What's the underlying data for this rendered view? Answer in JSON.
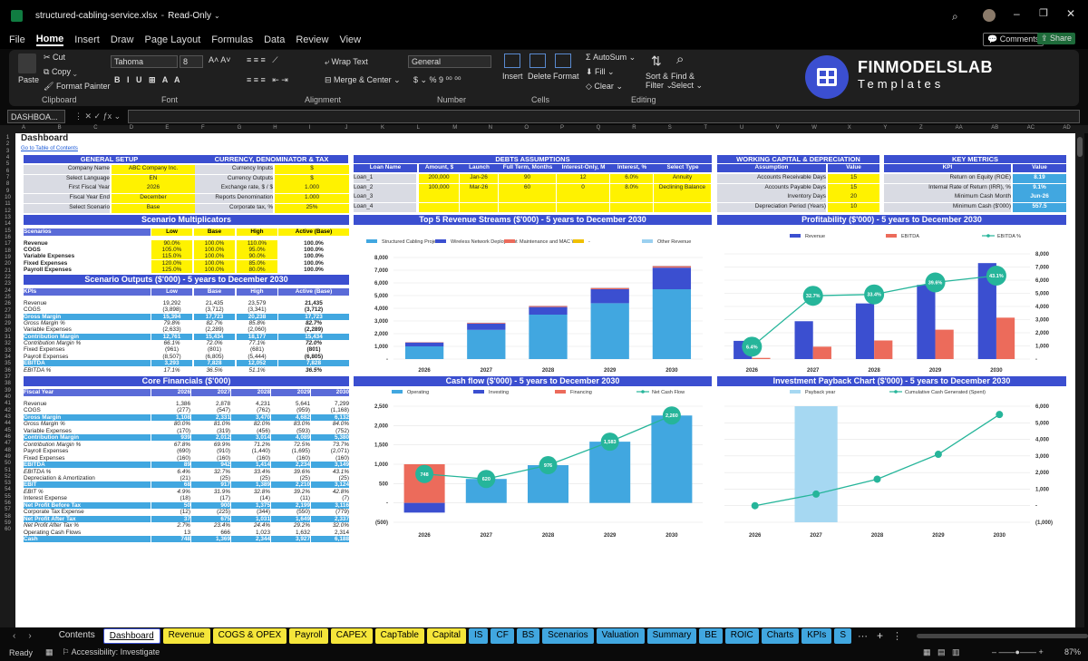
{
  "window": {
    "file": "structured-cabling-service.xlsx",
    "mode": "Read-Only"
  },
  "menus": [
    "File",
    "Home",
    "Insert",
    "Draw",
    "Page Layout",
    "Formulas",
    "Data",
    "Review",
    "View"
  ],
  "top_right": {
    "comments": "Comments",
    "share": "Share"
  },
  "ribbon": {
    "paste": "Paste",
    "cut": "Cut",
    "copy": "Copy",
    "format_painter": "Format Painter",
    "clipboard": "Clipboard",
    "font_name": "Tahoma",
    "font_size": "8",
    "font": "Font",
    "wrap": "Wrap Text",
    "merge": "Merge & Center",
    "alignment": "Alignment",
    "number_format": "General",
    "number": "Number",
    "insert": "Insert",
    "delete": "Delete",
    "format": "Format",
    "cells": "Cells",
    "autosum": "AutoSum",
    "fill": "Fill",
    "clear": "Clear",
    "sort": "Sort &",
    "sort2": "Filter",
    "find": "Find &",
    "find2": "Select",
    "editing": "Editing",
    "brand1": "FINMODELSLAB",
    "brand2": "Templates"
  },
  "namebox": "DASHBOA...",
  "columns": [
    "A",
    "B",
    "C",
    "D",
    "E",
    "F",
    "G",
    "H",
    "I",
    "J",
    "K",
    "L",
    "M",
    "N",
    "O",
    "P",
    "Q",
    "R",
    "S",
    "T",
    "U",
    "V",
    "W",
    "X",
    "Y",
    "Z",
    "AA",
    "AB",
    "AC",
    "AD"
  ],
  "sheet": {
    "title": "Dashboard",
    "link": "Go to Table of Contents",
    "general": {
      "title": "GENERAL SETUP",
      "rows": [
        [
          "Company Name",
          "ABC Company Inc."
        ],
        [
          "Select Language",
          "EN"
        ],
        [
          "First Fiscal Year",
          "2026"
        ],
        [
          "Fiscal Year End",
          "December"
        ],
        [
          "Select Scenario",
          "Base"
        ]
      ]
    },
    "currency": {
      "title": "CURRENCY, DENOMINATOR & TAX",
      "rows": [
        [
          "Currency Inputs",
          "$"
        ],
        [
          "Currency Outputs",
          "$"
        ],
        [
          "Exchange rate, $ / $",
          "1.000"
        ],
        [
          "Reports Denomination",
          "1.000"
        ],
        [
          "Corporate tax, %",
          "25%"
        ]
      ]
    },
    "debts": {
      "title": "DEBTS ASSUMPTIONS",
      "headers": [
        "Loan Name",
        "Amount, $",
        "Launch",
        "Full Term, Months",
        "Interest-Only, M",
        "Interest, %",
        "Select Type"
      ],
      "rows": [
        [
          "Loan_1",
          "200,000",
          "Jan-26",
          "90",
          "12",
          "6.0%",
          "Annuity"
        ],
        [
          "Loan_2",
          "100,000",
          "Mar-26",
          "60",
          "0",
          "8.0%",
          "Declining Balance"
        ],
        [
          "Loan_3",
          "",
          "",
          "",
          "",
          "",
          ""
        ],
        [
          "Loan_4",
          "",
          "",
          "",
          "",
          "",
          ""
        ]
      ]
    },
    "wc": {
      "title": "WORKING CAPITAL & DEPRECIATION",
      "headers": [
        "Assumption",
        "Value"
      ],
      "rows": [
        [
          "Accounts Receivable Days",
          "15"
        ],
        [
          "Accounts Payable Days",
          "15"
        ],
        [
          "Inventory Days",
          "20"
        ],
        [
          "Depreciation Period (Years)",
          "10"
        ]
      ]
    },
    "kpi": {
      "title": "KEY METRICS",
      "headers": [
        "KPI",
        "Value"
      ],
      "rows": [
        [
          "Return on Equity (ROE)",
          "8.19"
        ],
        [
          "Internal Rate of Return (IRR), %",
          "9.1%"
        ],
        [
          "Minimum Cash Month",
          "Jun-26"
        ],
        [
          "Minimum Cash ($'000)",
          "557.5"
        ]
      ]
    },
    "scen": {
      "title": "Scenario Multiplicators",
      "headers": [
        "Scenarios",
        "Low",
        "Base",
        "High",
        "Active (Base)"
      ],
      "rows": [
        [
          "Revenue",
          "90.0%",
          "100.0%",
          "110.0%",
          "100.0%"
        ],
        [
          "COGS",
          "105.0%",
          "100.0%",
          "95.0%",
          "100.0%"
        ],
        [
          "Variable Expenses",
          "115.0%",
          "100.0%",
          "90.0%",
          "100.0%"
        ],
        [
          "Fixed Expenses",
          "120.0%",
          "100.0%",
          "85.0%",
          "100.0%"
        ],
        [
          "Payroll Expenses",
          "125.0%",
          "100.0%",
          "80.0%",
          "100.0%"
        ]
      ]
    },
    "outputs": {
      "title": "Scenario Outputs ($'000) - 5 years to December 2030",
      "headers": [
        "KPIs",
        "Low",
        "Base",
        "High",
        "Active (Base)"
      ],
      "rows": [
        [
          "Revenue",
          "19,292",
          "21,435",
          "23,579",
          "21,435"
        ],
        [
          "COGS",
          "(3,898)",
          "(3,712)",
          "(3,341)",
          "(3,712)"
        ],
        [
          "Gross Margin",
          "15,394",
          "17,723",
          "20,238",
          "17,723"
        ],
        [
          "Gross Margin %",
          "79.8%",
          "82.7%",
          "85.8%",
          "82.7%"
        ],
        [
          "Variable Expenses",
          "(2,633)",
          "(2,289)",
          "(2,060)",
          "(2,289)"
        ],
        [
          "Contribution Margin",
          "12,761",
          "15,434",
          "18,177",
          "15,434"
        ],
        [
          "Contribution Margin %",
          "66.1%",
          "72.0%",
          "77.1%",
          "72.0%"
        ],
        [
          "Fixed Expenses",
          "(961)",
          "(801)",
          "(681)",
          "(801)"
        ],
        [
          "Payroll Expenses",
          "(8,507)",
          "(6,805)",
          "(5,444)",
          "(6,805)"
        ],
        [
          "EBITDA",
          "3,293",
          "7,828",
          "12,052",
          "7,828"
        ],
        [
          "EBITDA %",
          "17.1%",
          "36.5%",
          "51.1%",
          "36.5%"
        ]
      ]
    },
    "core": {
      "title": "Core Financials ($'000)",
      "headers": [
        "Fiscal Year",
        "2026",
        "2027",
        "2028",
        "2029",
        "2030"
      ],
      "rows": [
        [
          "Revenue",
          "1,386",
          "2,878",
          "4,231",
          "5,641",
          "7,299"
        ],
        [
          "COGS",
          "(277)",
          "(547)",
          "(762)",
          "(959)",
          "(1,168)"
        ],
        [
          "Gross Margin",
          "1,108",
          "2,331",
          "3,470",
          "4,682",
          "6,132"
        ],
        [
          "Gross Margin %",
          "80.0%",
          "81.0%",
          "82.0%",
          "83.0%",
          "84.0%"
        ],
        [
          "Variable Expenses",
          "(170)",
          "(319)",
          "(456)",
          "(593)",
          "(752)"
        ],
        [
          "Contribution Margin",
          "939",
          "2,012",
          "3,014",
          "4,089",
          "5,380"
        ],
        [
          "Contribution Margin %",
          "67.8%",
          "69.9%",
          "71.2%",
          "72.5%",
          "73.7%"
        ],
        [
          "Payroll Expenses",
          "(690)",
          "(910)",
          "(1,440)",
          "(1,695)",
          "(2,071)"
        ],
        [
          "Fixed Expenses",
          "(160)",
          "(160)",
          "(160)",
          "(160)",
          "(160)"
        ],
        [
          "EBITDA",
          "89",
          "942",
          "1,414",
          "2,234",
          "3,149"
        ],
        [
          "EBITDA %",
          "6.4%",
          "32.7%",
          "33.4%",
          "39.6%",
          "43.1%"
        ],
        [
          "Depreciation & Amortization",
          "(21)",
          "(25)",
          "(25)",
          "(25)",
          "(25)"
        ],
        [
          "EBIT",
          "68",
          "917",
          "1,389",
          "2,210",
          "3,124"
        ],
        [
          "EBIT %",
          "4.9%",
          "31.9%",
          "32.8%",
          "39.2%",
          "42.8%"
        ],
        [
          "Interest Expense",
          "(18)",
          "(17)",
          "(14)",
          "(11)",
          "(7)"
        ],
        [
          "Net Profit Before Tax",
          "50",
          "900",
          "1,375",
          "2,199",
          "3,116"
        ],
        [
          "Corporate Tax Expense",
          "(12)",
          "(225)",
          "(344)",
          "(550)",
          "(779)"
        ],
        [
          "Net Profit After Tax",
          "37",
          "675",
          "1,031",
          "1,649",
          "2,337"
        ],
        [
          "Net Profit After Tax %",
          "2.7%",
          "23.4%",
          "24.4%",
          "29.2%",
          "32.0%"
        ],
        [
          "Operating Cash Flows",
          "13",
          "666",
          "1,023",
          "1,632",
          "2,314"
        ],
        [
          "Cash",
          "748",
          "1,369",
          "2,344",
          "3,927",
          "6,188"
        ]
      ]
    }
  },
  "chart_data": [
    {
      "type": "bar",
      "title": "Top 5 Revenue Streams ($'000) - 5 years to December 2030",
      "categories": [
        "2026",
        "2027",
        "2028",
        "2029",
        "2030"
      ],
      "series": [
        {
          "name": "Structured Cabling Projects",
          "values": [
            1000,
            2300,
            3500,
            4400,
            5500
          ],
          "color": "#41a7e0"
        },
        {
          "name": "Wireless Network Deployment",
          "values": [
            300,
            500,
            600,
            1100,
            1700
          ],
          "color": "#3b4fd0"
        },
        {
          "name": "Maintenance and MAC Work",
          "values": [
            30,
            60,
            80,
            100,
            120
          ],
          "color": "#ec6b5b"
        },
        {
          "name": "-",
          "values": [
            0,
            0,
            0,
            0,
            0
          ],
          "color": "#f0c000"
        },
        {
          "name": "Other Revenue",
          "values": [
            10,
            15,
            20,
            25,
            30
          ],
          "color": "#9bd0f0"
        }
      ],
      "ylim": [
        0,
        8000
      ],
      "yticks": [
        "-",
        "1,000",
        "2,000",
        "3,000",
        "4,000",
        "5,000",
        "6,000",
        "7,000",
        "8,000"
      ]
    },
    {
      "type": "bar",
      "title": "Profitability ($'000) - 5 years to December 2030",
      "categories": [
        "2026",
        "2027",
        "2028",
        "2029",
        "2030"
      ],
      "series": [
        {
          "name": "Revenue",
          "values": [
            1386,
            2878,
            4231,
            5641,
            7299
          ],
          "color": "#3b4fd0"
        },
        {
          "name": "EBITDA",
          "values": [
            89,
            942,
            1414,
            2234,
            3149
          ],
          "color": "#ec6b5b"
        },
        {
          "name": "EBITDA %",
          "values": [
            6.4,
            32.7,
            33.4,
            39.6,
            43.1
          ],
          "labels": [
            "6.4%",
            "32.7%",
            "33.4%",
            "39.6%",
            "43.1%"
          ],
          "color": "#26b59a"
        }
      ],
      "ylim": [
        0,
        8000
      ],
      "yticks": [
        "-",
        "1,000",
        "2,000",
        "3,000",
        "4,000",
        "5,000",
        "6,000",
        "7,000",
        "8,000"
      ]
    },
    {
      "type": "bar",
      "title": "Cash flow ($'000) - 5 years to December 2030",
      "categories": [
        "2026",
        "2027",
        "2028",
        "2029",
        "2030"
      ],
      "series": [
        {
          "name": "Operating",
          "values": [
            748,
            620,
            976,
            1583,
            2260
          ],
          "color": "#41a7e0"
        },
        {
          "name": "Investing",
          "values": [
            -250,
            0,
            0,
            0,
            0
          ],
          "color": "#3b4fd0"
        },
        {
          "name": "Financing",
          "values": [
            1000,
            0,
            0,
            0,
            0
          ],
          "color": "#ec6b5b"
        },
        {
          "name": "Net Cash Flow",
          "values": [
            748,
            620,
            976,
            1583,
            2260
          ],
          "labels": [
            "748",
            "620",
            "976",
            "1,583",
            "2,260"
          ],
          "color": "#26b59a"
        }
      ],
      "ylim": [
        -500,
        2500
      ],
      "yticks": [
        "(500)",
        "-",
        "500",
        "1,000",
        "1,500",
        "2,000",
        "2,500"
      ]
    },
    {
      "type": "line",
      "title": "Investment Payback Chart ($'000) - 5 years to December 2030",
      "categories": [
        "2026",
        "2027",
        "2028",
        "2029",
        "2030"
      ],
      "series": [
        {
          "name": "Payback year",
          "values": [
            0,
            6000,
            0,
            0,
            0
          ],
          "color": "#a6d8f2"
        },
        {
          "name": "Cumulative Cash Generated (Spent)",
          "values": [
            0,
            700,
            1600,
            3100,
            5500
          ],
          "color": "#26b59a"
        }
      ],
      "ylim": [
        -1000,
        6000
      ],
      "yticks": [
        "(1,000)",
        "-",
        "1,000",
        "2,000",
        "3,000",
        "4,000",
        "5,000",
        "6,000"
      ]
    }
  ],
  "tabs": [
    {
      "label": "Contents",
      "bg": "#0a0a0a",
      "fg": "#ddd"
    },
    {
      "label": "Dashboard",
      "bg": "#ffffff",
      "fg": "#000"
    },
    {
      "label": "Revenue",
      "bg": "#f5e63a",
      "fg": "#000"
    },
    {
      "label": "COGS & OPEX",
      "bg": "#f5e63a",
      "fg": "#000"
    },
    {
      "label": "Payroll",
      "bg": "#f5e63a",
      "fg": "#000"
    },
    {
      "label": "CAPEX",
      "bg": "#f5e63a",
      "fg": "#000"
    },
    {
      "label": "CapTable",
      "bg": "#f5e63a",
      "fg": "#000"
    },
    {
      "label": "Capital",
      "bg": "#f5e63a",
      "fg": "#000"
    },
    {
      "label": "IS",
      "bg": "#41a7e0",
      "fg": "#000"
    },
    {
      "label": "CF",
      "bg": "#41a7e0",
      "fg": "#000"
    },
    {
      "label": "BS",
      "bg": "#41a7e0",
      "fg": "#000"
    },
    {
      "label": "Scenarios",
      "bg": "#41a7e0",
      "fg": "#000"
    },
    {
      "label": "Valuation",
      "bg": "#41a7e0",
      "fg": "#000"
    },
    {
      "label": "Summary",
      "bg": "#41a7e0",
      "fg": "#000"
    },
    {
      "label": "BE",
      "bg": "#41a7e0",
      "fg": "#000"
    },
    {
      "label": "ROIC",
      "bg": "#41a7e0",
      "fg": "#000"
    },
    {
      "label": "Charts",
      "bg": "#41a7e0",
      "fg": "#000"
    },
    {
      "label": "KPIs",
      "bg": "#41a7e0",
      "fg": "#000"
    },
    {
      "label": "S",
      "bg": "#41a7e0",
      "fg": "#000"
    }
  ],
  "status": {
    "ready": "Ready",
    "accessibility": "Accessibility: Investigate",
    "zoom": "87%"
  }
}
